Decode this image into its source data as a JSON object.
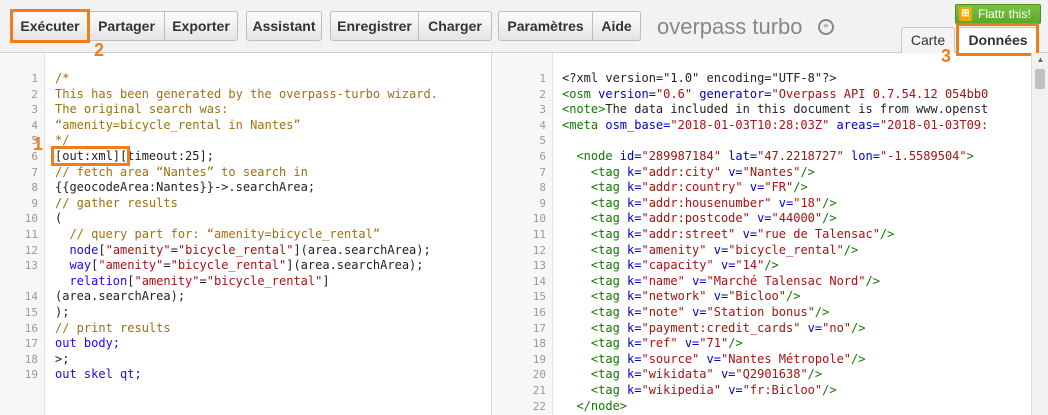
{
  "toolbar": {
    "run": "Exécuter",
    "share": "Partager",
    "export": "Exporter",
    "wizard": "Assistant",
    "save": "Enregistrer",
    "load": "Charger",
    "settings": "Paramètres",
    "help": "Aide"
  },
  "app_title": "overpass turbo",
  "flattr": "Flattr this!",
  "tabs": {
    "map": "Carte",
    "data": "Données"
  },
  "annotations": [
    "1",
    "2",
    "3"
  ],
  "left_lines": [
    {
      "n": "1",
      "tokens": [
        {
          "t": "/*",
          "c": "c-cm"
        }
      ]
    },
    {
      "n": "2",
      "tokens": [
        {
          "t": "This has been generated by the overpass-turbo wizard.",
          "c": "c-cm"
        }
      ]
    },
    {
      "n": "3",
      "tokens": [
        {
          "t": "The original search was:",
          "c": "c-cm"
        }
      ]
    },
    {
      "n": "4",
      "tokens": [
        {
          "t": "“amenity=bicycle_rental in Nantes”",
          "c": "c-cm"
        }
      ]
    },
    {
      "n": "5",
      "tokens": [
        {
          "t": "*/",
          "c": "c-cm"
        }
      ]
    },
    {
      "n": "6",
      "tokens": [
        {
          "t": "[out:xml]",
          "c": ""
        },
        {
          "t": "[timeout:25];",
          "c": ""
        }
      ]
    },
    {
      "n": "7",
      "tokens": [
        {
          "t": "// fetch area “Nantes” to search in",
          "c": "c-cm"
        }
      ]
    },
    {
      "n": "8",
      "tokens": [
        {
          "t": "{{geocodeArea:Nantes}}",
          "c": ""
        },
        {
          "t": "->.searchArea;",
          "c": ""
        }
      ]
    },
    {
      "n": "9",
      "tokens": [
        {
          "t": "// gather results",
          "c": "c-cm"
        }
      ]
    },
    {
      "n": "10",
      "tokens": [
        {
          "t": "(",
          "c": ""
        }
      ]
    },
    {
      "n": "11",
      "tokens": [
        {
          "t": "  // query part for: “amenity=bicycle_rental”",
          "c": "c-cm"
        }
      ]
    },
    {
      "n": "12",
      "tokens": [
        {
          "t": "  node",
          "c": "c-kw"
        },
        {
          "t": "[",
          "c": ""
        },
        {
          "t": "\"amenity\"",
          "c": "c-str"
        },
        {
          "t": "=",
          "c": ""
        },
        {
          "t": "\"bicycle_rental\"",
          "c": "c-str"
        },
        {
          "t": "](area.searchArea);",
          "c": ""
        }
      ]
    },
    {
      "n": "13",
      "tokens": [
        {
          "t": "  way",
          "c": "c-kw"
        },
        {
          "t": "[",
          "c": ""
        },
        {
          "t": "\"amenity\"",
          "c": "c-str"
        },
        {
          "t": "=",
          "c": ""
        },
        {
          "t": "\"bicycle_rental\"",
          "c": "c-str"
        },
        {
          "t": "](area.searchArea);",
          "c": ""
        }
      ]
    },
    {
      "n": "",
      "tokens": [
        {
          "t": "  relation",
          "c": "c-kw"
        },
        {
          "t": "[",
          "c": ""
        },
        {
          "t": "\"amenity\"",
          "c": "c-str"
        },
        {
          "t": "=",
          "c": ""
        },
        {
          "t": "\"bicycle_rental\"",
          "c": "c-str"
        },
        {
          "t": "]",
          "c": ""
        }
      ]
    },
    {
      "n": "14",
      "tokens": [
        {
          "t": "(area.searchArea);",
          "c": ""
        }
      ]
    },
    {
      "n": "15",
      "tokens": [
        {
          "t": ");",
          "c": ""
        }
      ]
    },
    {
      "n": "16",
      "tokens": [
        {
          "t": "// print results",
          "c": "c-cm"
        }
      ]
    },
    {
      "n": "17",
      "tokens": [
        {
          "t": "out body;",
          "c": "c-kw"
        }
      ]
    },
    {
      "n": "18",
      "tokens": [
        {
          "t": ">;",
          "c": ""
        }
      ]
    },
    {
      "n": "19",
      "tokens": [
        {
          "t": "out skel qt;",
          "c": "c-kw"
        }
      ]
    }
  ],
  "right_lines": [
    {
      "n": "1",
      "tokens": [
        {
          "t": "<?xml version=\"1.0\" encoding=\"UTF-8\"?>",
          "c": ""
        }
      ]
    },
    {
      "n": "2",
      "tokens": [
        {
          "t": "<osm",
          "c": "c-tag"
        },
        {
          "t": " version=",
          "c": "c-attr"
        },
        {
          "t": "\"0.6\"",
          "c": "c-val"
        },
        {
          "t": " generator=",
          "c": "c-attr"
        },
        {
          "t": "\"Overpass API 0.7.54.12 054bb0",
          "c": "c-val"
        }
      ]
    },
    {
      "n": "3",
      "tokens": [
        {
          "t": "<note>",
          "c": "c-tag"
        },
        {
          "t": "The data included in this document is from www.openst",
          "c": ""
        }
      ]
    },
    {
      "n": "4",
      "tokens": [
        {
          "t": "<meta",
          "c": "c-tag"
        },
        {
          "t": " osm_base=",
          "c": "c-attr"
        },
        {
          "t": "\"2018-01-03T10:28:03Z\"",
          "c": "c-val"
        },
        {
          "t": " areas=",
          "c": "c-attr"
        },
        {
          "t": "\"2018-01-03T09:",
          "c": "c-val"
        }
      ]
    },
    {
      "n": "5",
      "tokens": []
    },
    {
      "n": "6",
      "tokens": [
        {
          "t": "  <node",
          "c": "c-tag"
        },
        {
          "t": " id=",
          "c": "c-attr"
        },
        {
          "t": "\"289987184\"",
          "c": "c-val"
        },
        {
          "t": " lat=",
          "c": "c-attr"
        },
        {
          "t": "\"47.2218727\"",
          "c": "c-val"
        },
        {
          "t": " lon=",
          "c": "c-attr"
        },
        {
          "t": "\"-1.5589504\"",
          "c": "c-val"
        },
        {
          "t": ">",
          "c": "c-tag"
        }
      ]
    },
    {
      "n": "7",
      "tokens": [
        {
          "t": "    <tag",
          "c": "c-tag"
        },
        {
          "t": " k=",
          "c": "c-attr"
        },
        {
          "t": "\"addr:city\"",
          "c": "c-val"
        },
        {
          "t": " v=",
          "c": "c-attr"
        },
        {
          "t": "\"Nantes\"",
          "c": "c-val"
        },
        {
          "t": "/>",
          "c": "c-tag"
        }
      ]
    },
    {
      "n": "8",
      "tokens": [
        {
          "t": "    <tag",
          "c": "c-tag"
        },
        {
          "t": " k=",
          "c": "c-attr"
        },
        {
          "t": "\"addr:country\"",
          "c": "c-val"
        },
        {
          "t": " v=",
          "c": "c-attr"
        },
        {
          "t": "\"FR\"",
          "c": "c-val"
        },
        {
          "t": "/>",
          "c": "c-tag"
        }
      ]
    },
    {
      "n": "9",
      "tokens": [
        {
          "t": "    <tag",
          "c": "c-tag"
        },
        {
          "t": " k=",
          "c": "c-attr"
        },
        {
          "t": "\"addr:housenumber\"",
          "c": "c-val"
        },
        {
          "t": " v=",
          "c": "c-attr"
        },
        {
          "t": "\"18\"",
          "c": "c-val"
        },
        {
          "t": "/>",
          "c": "c-tag"
        }
      ]
    },
    {
      "n": "10",
      "tokens": [
        {
          "t": "    <tag",
          "c": "c-tag"
        },
        {
          "t": " k=",
          "c": "c-attr"
        },
        {
          "t": "\"addr:postcode\"",
          "c": "c-val"
        },
        {
          "t": " v=",
          "c": "c-attr"
        },
        {
          "t": "\"44000\"",
          "c": "c-val"
        },
        {
          "t": "/>",
          "c": "c-tag"
        }
      ]
    },
    {
      "n": "11",
      "tokens": [
        {
          "t": "    <tag",
          "c": "c-tag"
        },
        {
          "t": " k=",
          "c": "c-attr"
        },
        {
          "t": "\"addr:street\"",
          "c": "c-val"
        },
        {
          "t": " v=",
          "c": "c-attr"
        },
        {
          "t": "\"rue de Talensac\"",
          "c": "c-val"
        },
        {
          "t": "/>",
          "c": "c-tag"
        }
      ]
    },
    {
      "n": "12",
      "tokens": [
        {
          "t": "    <tag",
          "c": "c-tag"
        },
        {
          "t": " k=",
          "c": "c-attr"
        },
        {
          "t": "\"amenity\"",
          "c": "c-val"
        },
        {
          "t": " v=",
          "c": "c-attr"
        },
        {
          "t": "\"bicycle_rental\"",
          "c": "c-val"
        },
        {
          "t": "/>",
          "c": "c-tag"
        }
      ]
    },
    {
      "n": "13",
      "tokens": [
        {
          "t": "    <tag",
          "c": "c-tag"
        },
        {
          "t": " k=",
          "c": "c-attr"
        },
        {
          "t": "\"capacity\"",
          "c": "c-val"
        },
        {
          "t": " v=",
          "c": "c-attr"
        },
        {
          "t": "\"14\"",
          "c": "c-val"
        },
        {
          "t": "/>",
          "c": "c-tag"
        }
      ]
    },
    {
      "n": "14",
      "tokens": [
        {
          "t": "    <tag",
          "c": "c-tag"
        },
        {
          "t": " k=",
          "c": "c-attr"
        },
        {
          "t": "\"name\"",
          "c": "c-val"
        },
        {
          "t": " v=",
          "c": "c-attr"
        },
        {
          "t": "\"Marché Talensac Nord\"",
          "c": "c-val"
        },
        {
          "t": "/>",
          "c": "c-tag"
        }
      ]
    },
    {
      "n": "15",
      "tokens": [
        {
          "t": "    <tag",
          "c": "c-tag"
        },
        {
          "t": " k=",
          "c": "c-attr"
        },
        {
          "t": "\"network\"",
          "c": "c-val"
        },
        {
          "t": " v=",
          "c": "c-attr"
        },
        {
          "t": "\"Bicloo\"",
          "c": "c-val"
        },
        {
          "t": "/>",
          "c": "c-tag"
        }
      ]
    },
    {
      "n": "16",
      "tokens": [
        {
          "t": "    <tag",
          "c": "c-tag"
        },
        {
          "t": " k=",
          "c": "c-attr"
        },
        {
          "t": "\"note\"",
          "c": "c-val"
        },
        {
          "t": " v=",
          "c": "c-attr"
        },
        {
          "t": "\"Station bonus\"",
          "c": "c-val"
        },
        {
          "t": "/>",
          "c": "c-tag"
        }
      ]
    },
    {
      "n": "17",
      "tokens": [
        {
          "t": "    <tag",
          "c": "c-tag"
        },
        {
          "t": " k=",
          "c": "c-attr"
        },
        {
          "t": "\"payment:credit_cards\"",
          "c": "c-val"
        },
        {
          "t": " v=",
          "c": "c-attr"
        },
        {
          "t": "\"no\"",
          "c": "c-val"
        },
        {
          "t": "/>",
          "c": "c-tag"
        }
      ]
    },
    {
      "n": "18",
      "tokens": [
        {
          "t": "    <tag",
          "c": "c-tag"
        },
        {
          "t": " k=",
          "c": "c-attr"
        },
        {
          "t": "\"ref\"",
          "c": "c-val"
        },
        {
          "t": " v=",
          "c": "c-attr"
        },
        {
          "t": "\"71\"",
          "c": "c-val"
        },
        {
          "t": "/>",
          "c": "c-tag"
        }
      ]
    },
    {
      "n": "19",
      "tokens": [
        {
          "t": "    <tag",
          "c": "c-tag"
        },
        {
          "t": " k=",
          "c": "c-attr"
        },
        {
          "t": "\"source\"",
          "c": "c-val"
        },
        {
          "t": " v=",
          "c": "c-attr"
        },
        {
          "t": "\"Nantes Métropole\"",
          "c": "c-val"
        },
        {
          "t": "/>",
          "c": "c-tag"
        }
      ]
    },
    {
      "n": "20",
      "tokens": [
        {
          "t": "    <tag",
          "c": "c-tag"
        },
        {
          "t": " k=",
          "c": "c-attr"
        },
        {
          "t": "\"wikidata\"",
          "c": "c-val"
        },
        {
          "t": " v=",
          "c": "c-attr"
        },
        {
          "t": "\"Q2901638\"",
          "c": "c-val"
        },
        {
          "t": "/>",
          "c": "c-tag"
        }
      ]
    },
    {
      "n": "21",
      "tokens": [
        {
          "t": "    <tag",
          "c": "c-tag"
        },
        {
          "t": " k=",
          "c": "c-attr"
        },
        {
          "t": "\"wikipedia\"",
          "c": "c-val"
        },
        {
          "t": " v=",
          "c": "c-attr"
        },
        {
          "t": "\"fr:Bicloo\"",
          "c": "c-val"
        },
        {
          "t": "/>",
          "c": "c-tag"
        }
      ]
    },
    {
      "n": "22",
      "tokens": [
        {
          "t": "  </node>",
          "c": "c-tag"
        }
      ]
    }
  ],
  "colors": {
    "highlight": "#ef7d1a",
    "flattr_green": "#5aa72b"
  }
}
